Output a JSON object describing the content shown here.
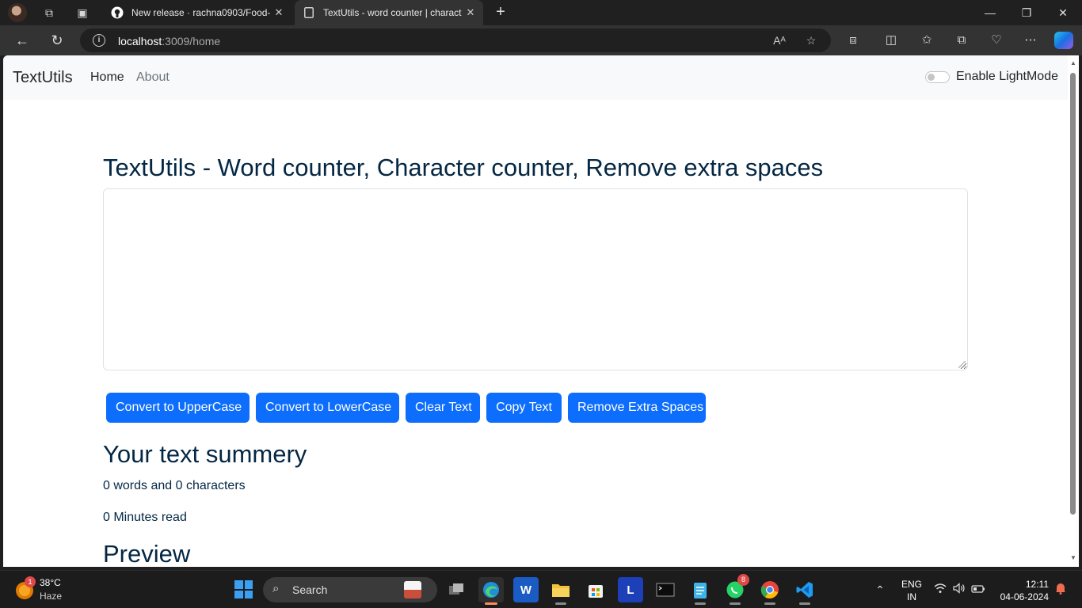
{
  "browser": {
    "tabs": [
      {
        "title": "New release · rachna0903/Food-",
        "favicon": "github-icon"
      },
      {
        "title": "TextUtils - word counter | charact",
        "favicon": "page-icon"
      }
    ],
    "address": {
      "host": "localhost",
      "path": ":3009/home"
    }
  },
  "navbar": {
    "brand": "TextUtils",
    "links": [
      {
        "label": "Home"
      },
      {
        "label": "About"
      }
    ],
    "switch_label": "Enable LightMode"
  },
  "main": {
    "heading": "TextUtils - Word counter, Character counter, Remove extra spaces",
    "textarea_value": "",
    "buttons": [
      {
        "label": "Convert to UpperCase"
      },
      {
        "label": "Convert to LowerCase"
      },
      {
        "label": "Clear Text"
      },
      {
        "label": "Copy Text"
      },
      {
        "label": "Remove Extra Spaces"
      }
    ],
    "summary_title": "Your text summery",
    "word_char_count": "0 words and 0 characters",
    "read_time": "0 Minutes read",
    "preview_title": "Preview"
  },
  "taskbar": {
    "weather": {
      "temp": "38°C",
      "condition": "Haze",
      "badge": "1"
    },
    "search_placeholder": "Search",
    "apps": [
      {
        "name": "task-view",
        "label": ""
      },
      {
        "name": "edge",
        "label": ""
      },
      {
        "name": "word",
        "label": "W"
      },
      {
        "name": "file-explorer",
        "label": ""
      },
      {
        "name": "microsoft-store",
        "label": ""
      },
      {
        "name": "l-app",
        "label": "L"
      },
      {
        "name": "terminal",
        "label": ""
      },
      {
        "name": "notepad",
        "label": ""
      },
      {
        "name": "whatsapp",
        "label": "",
        "badge": "8"
      },
      {
        "name": "chrome",
        "label": ""
      },
      {
        "name": "vscode",
        "label": ""
      }
    ],
    "language": {
      "line1": "ENG",
      "line2": "IN"
    },
    "clock": {
      "time": "12:11",
      "date": "04-06-2024"
    }
  },
  "colors": {
    "primary_button": "#0d6efd",
    "heading_text": "#042743",
    "navbar_bg": "#f8f9fa"
  }
}
